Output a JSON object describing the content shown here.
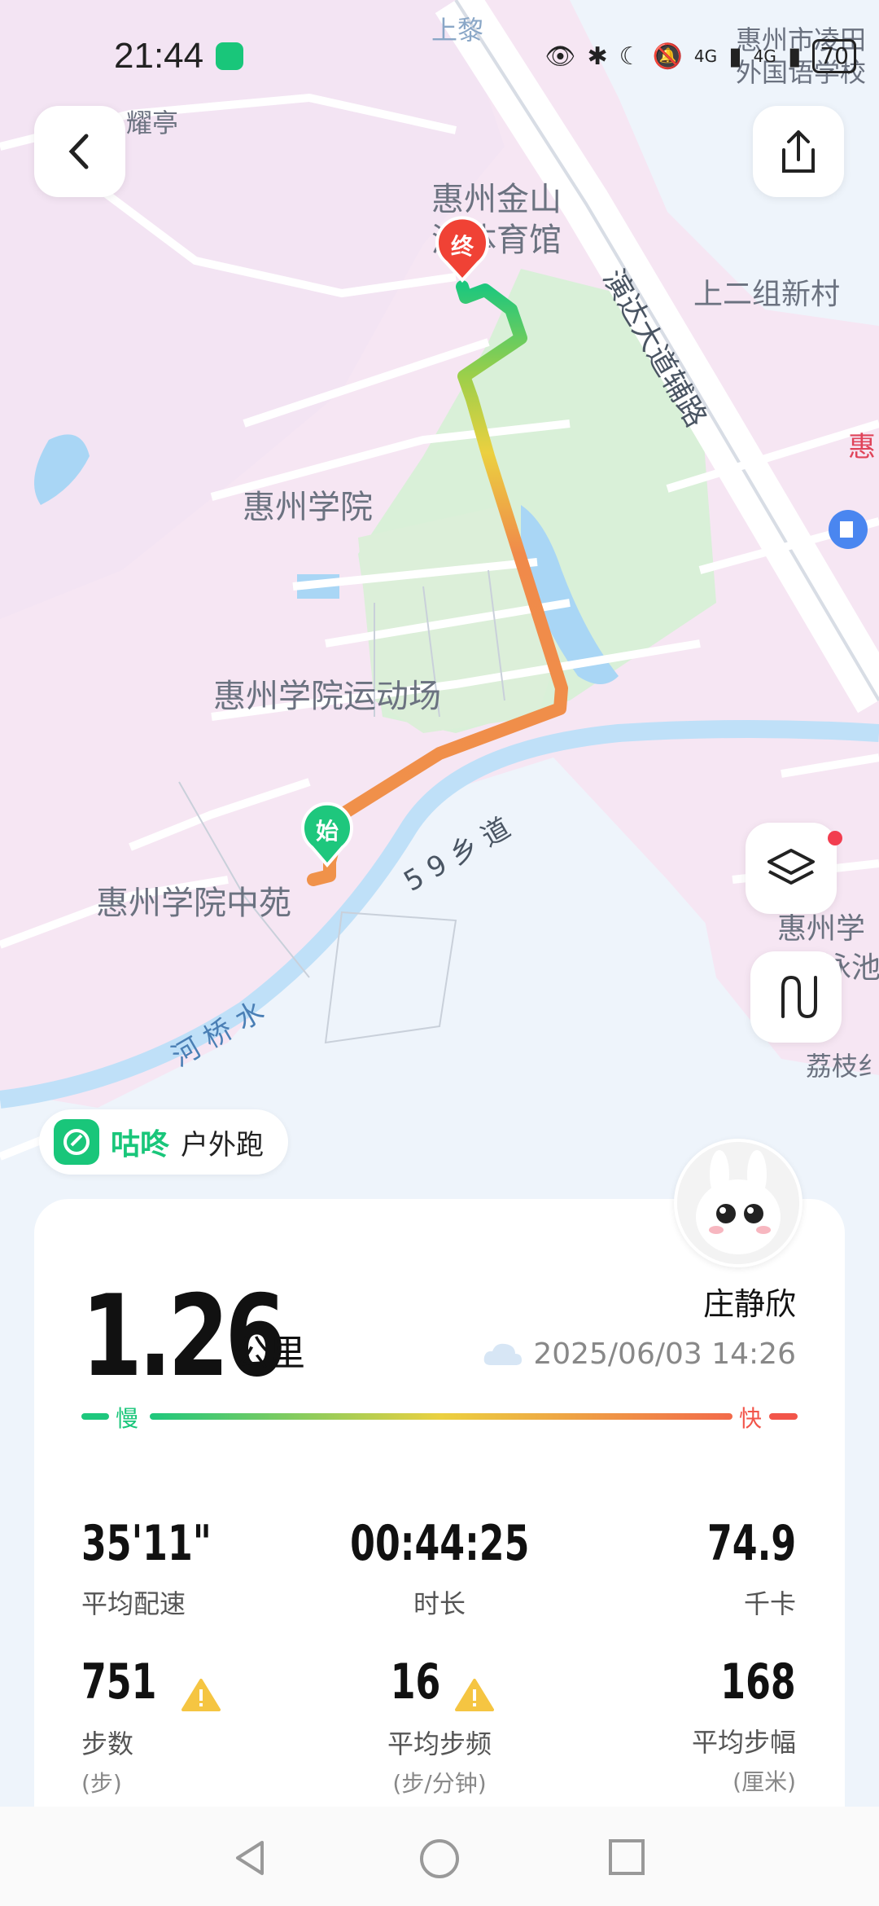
{
  "status_bar": {
    "time": "21:44",
    "net1": "4G",
    "net2": "4G",
    "battery": "70"
  },
  "map": {
    "labels": {
      "shangli": "上黎",
      "yaoting": "耀亭",
      "huizhou_jinshan": "惠州金山",
      "tiyuguan": "湖体育馆",
      "yanda": "演达大道辅路",
      "shang_erzu": "上二组新村",
      "huizhou_school_right": "惠州市凌田",
      "foreign_school": "外国语学校",
      "hui": "惠",
      "huizhou_xueyuan": "惠州学院",
      "stadium": "惠州学院运动场",
      "zhongyuan": "惠州学院中苑",
      "road59": "5 9 乡 道",
      "heqiaoshui": "河 桥 水",
      "huizhou_right": "惠州学",
      "swim": "泳池",
      "lizhi": "荔枝纟"
    },
    "end_marker": "终",
    "start_marker": "始",
    "icons": {
      "back": "chevron-left-icon",
      "share": "share-icon",
      "layers": "layers-icon",
      "route": "route-icon",
      "gas": "gas-station-icon"
    }
  },
  "app_tag": {
    "name": "咕咚",
    "activity": "户外跑"
  },
  "summary": {
    "distance": "1.26",
    "distance_unit": "公里",
    "user": "庄静欣",
    "datetime": "2025/06/03 14:26",
    "speed_slow": "慢",
    "speed_fast": "快"
  },
  "stats": [
    {
      "value": "35'11\"",
      "label": "平均配速",
      "unit": ""
    },
    {
      "value": "00:44:25",
      "label": "时长",
      "unit": ""
    },
    {
      "value": "74.9",
      "label": "千卡",
      "unit": ""
    },
    {
      "value": "751",
      "label": "步数",
      "unit": "(步)",
      "warning": true
    },
    {
      "value": "16",
      "label": "平均步频",
      "unit": "(步/分钟)",
      "warning": true
    },
    {
      "value": "168",
      "label": "平均步幅",
      "unit": "(厘米)"
    }
  ],
  "colors": {
    "accent": "#19c67a",
    "fast": "#f2554a",
    "route_orange": "#f0924a",
    "route_green": "#1ec77d"
  }
}
